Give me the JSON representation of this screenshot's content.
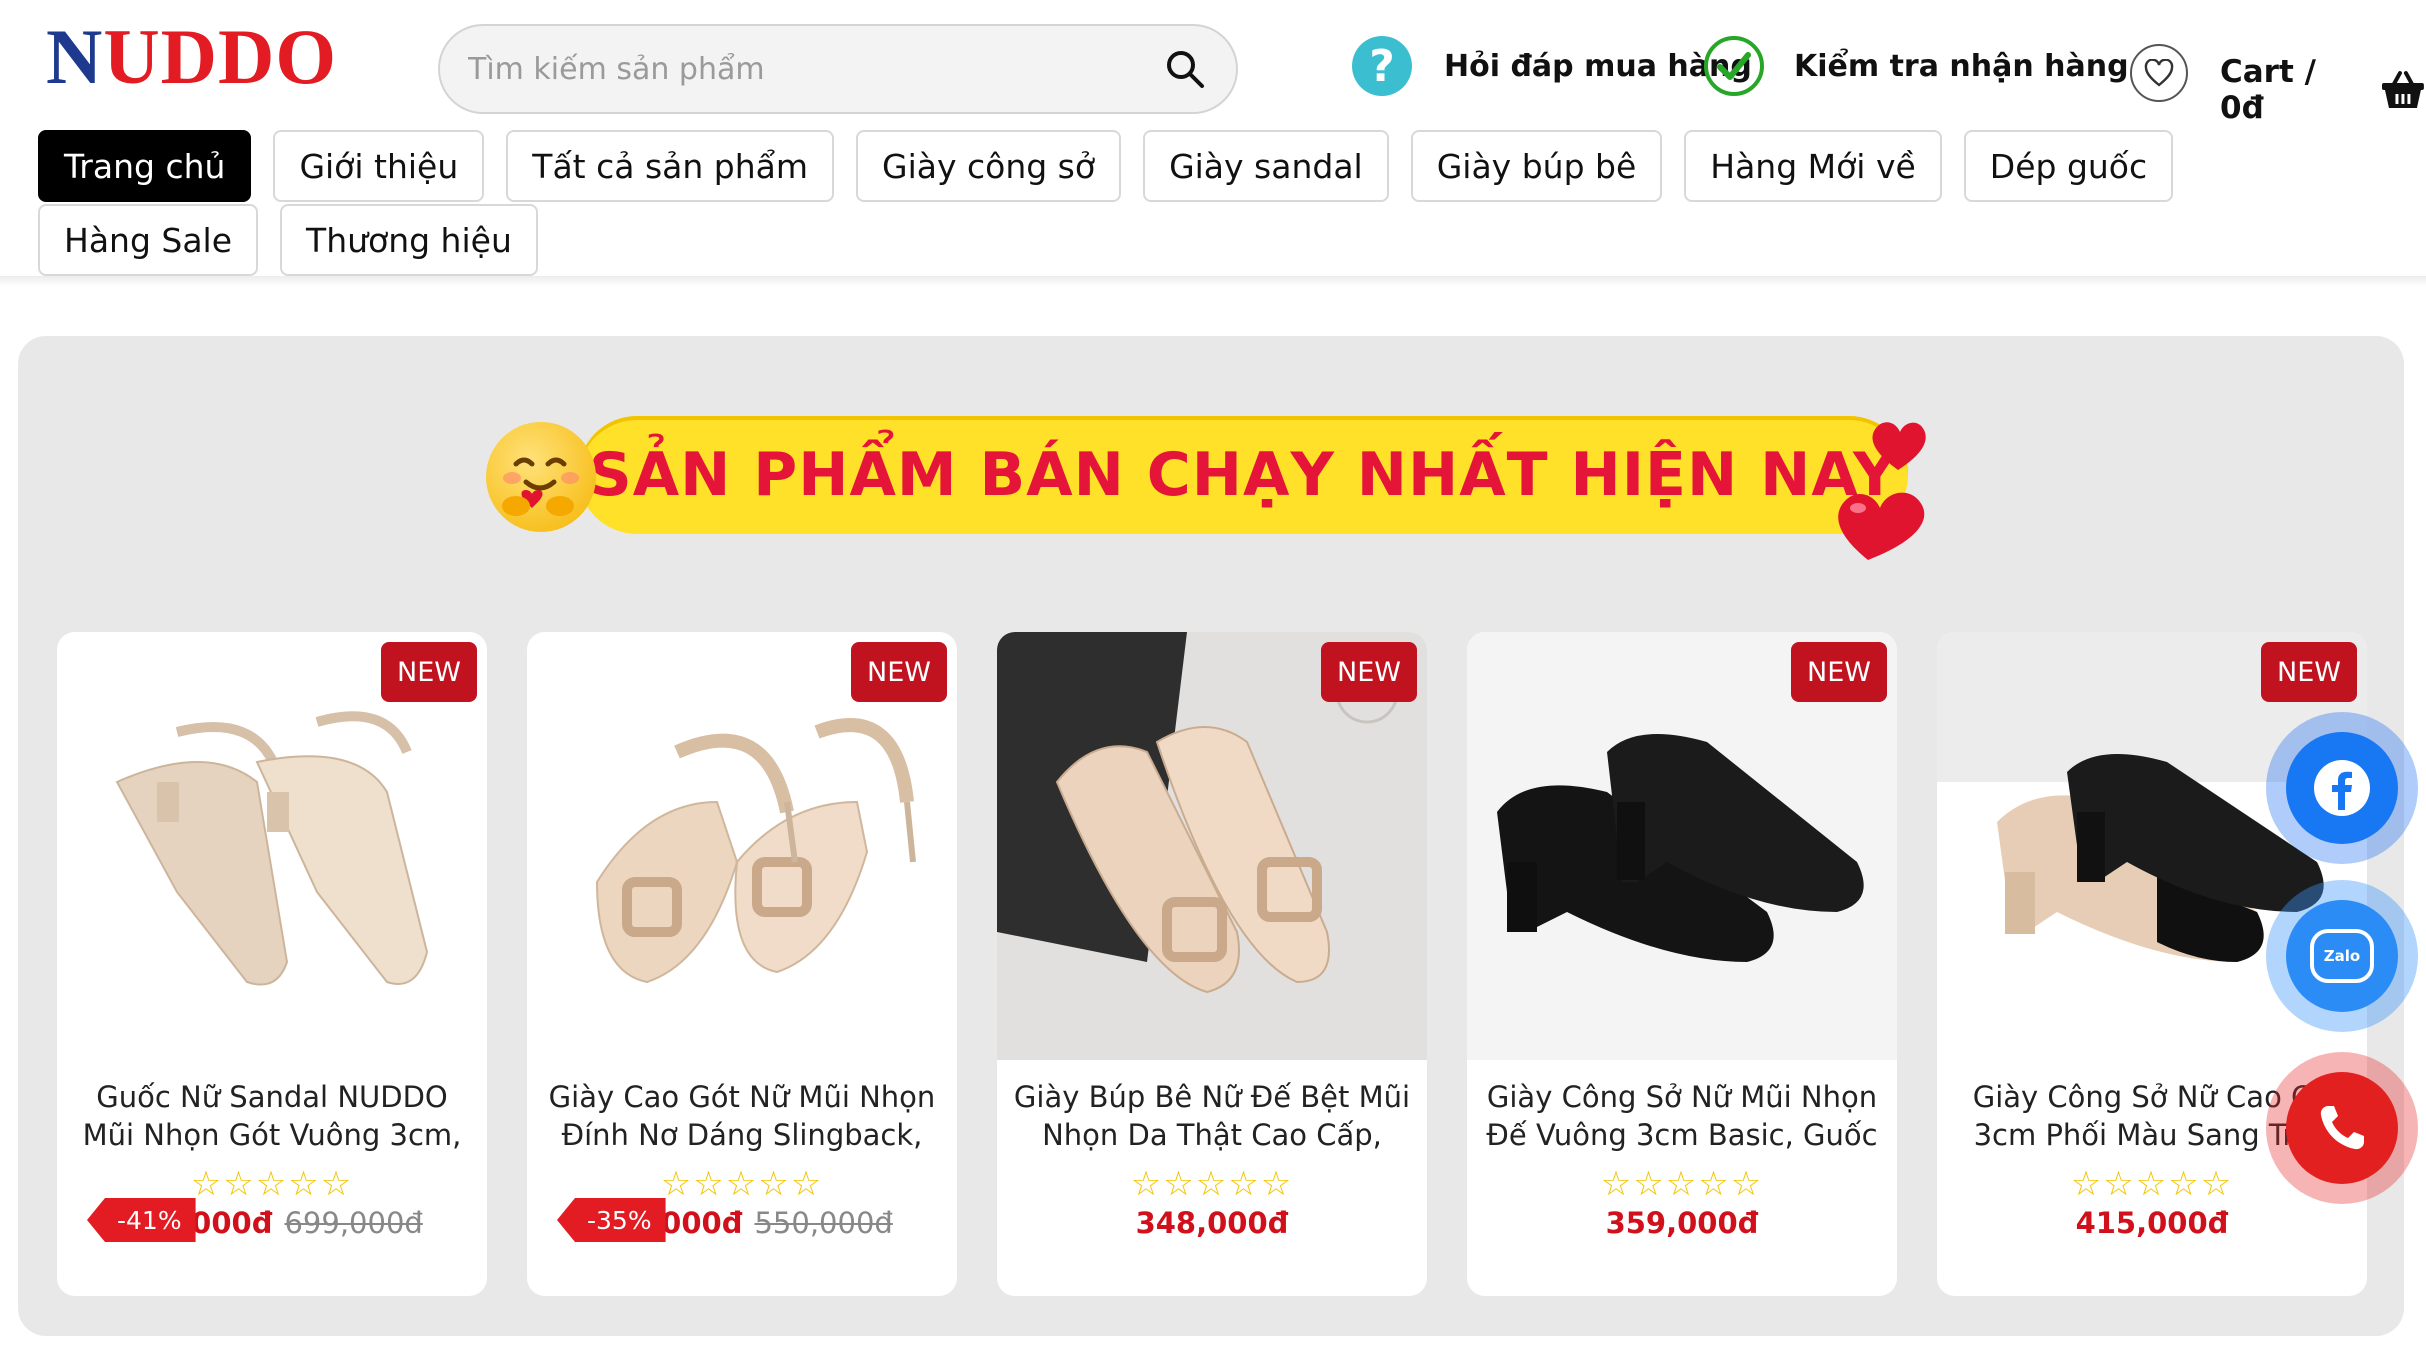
{
  "logo": {
    "n": "N",
    "rest": "UDDO"
  },
  "search": {
    "placeholder": "Tìm kiếm sản phẩm"
  },
  "header_links": {
    "faq": "Hỏi đáp mua hàng",
    "check": "Kiểm tra nhận hàng",
    "cart": "Cart / 0đ"
  },
  "nav": [
    {
      "label": "Trang chủ",
      "active": true
    },
    {
      "label": "Giới thiệu"
    },
    {
      "label": "Tất cả sản phẩm"
    },
    {
      "label": "Giày công sở"
    },
    {
      "label": "Giày sandal"
    },
    {
      "label": "Giày búp bê"
    },
    {
      "label": "Hàng Mới về"
    },
    {
      "label": "Dép guốc"
    },
    {
      "label": "Hàng Sale"
    },
    {
      "label": "Thương hiệu"
    }
  ],
  "banner": {
    "title": "SẢN PHẨM BÁN CHẠY NHẤT HIỆN NAY"
  },
  "products": [
    {
      "badge": "NEW",
      "title_line1": "Guốc Nữ Sandal NUDDO",
      "title_line2": "Mũi Nhọn Gót Vuông 3cm,",
      "stars": "☆☆☆☆☆",
      "price": "000đ",
      "old_price": "699,000đ",
      "discount": "-41%"
    },
    {
      "badge": "NEW",
      "title_line1": "Giày Cao Gót Nữ Mũi Nhọn",
      "title_line2": "Đính Nơ Dáng Slingback,",
      "stars": "☆☆☆☆☆",
      "price": "000đ",
      "old_price": "550,000đ",
      "discount": "-35%"
    },
    {
      "badge": "NEW",
      "title_line1": "Giày Búp Bê Nữ Đế Bệt Mũi",
      "title_line2": "Nhọn Da Thật Cao Cấp,",
      "stars": "☆☆☆☆☆",
      "price": "348,000đ"
    },
    {
      "badge": "NEW",
      "title_line1": "Giày Công Sở Nữ Mũi Nhọn",
      "title_line2": "Đế Vuông 3cm Basic, Guốc",
      "stars": "☆☆☆☆☆",
      "price": "359,000đ"
    },
    {
      "badge": "NEW",
      "title_line1": "Giày Công Sở Nữ Cao Gó",
      "title_line2": "3cm Phối Màu Sang Trọn",
      "stars": "☆☆☆☆☆",
      "price": "415,000đ"
    }
  ],
  "floating": {
    "zalo": "Zalo"
  },
  "colors": {
    "brand_blue": "#1d3a8f",
    "brand_red": "#e31b23",
    "banner_yellow": "#ffe12a",
    "price_red": "#d0111b"
  }
}
